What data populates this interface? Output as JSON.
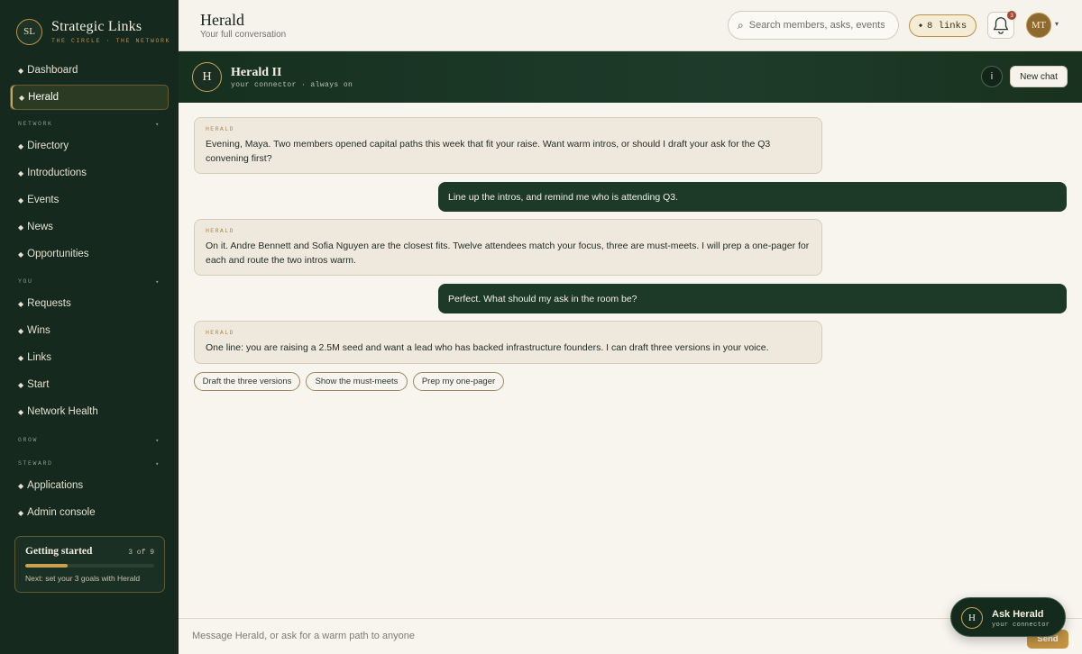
{
  "brand": {
    "mark": "SL",
    "name": "Strategic Links",
    "tagline": "THE CIRCLE · THE NETWORK"
  },
  "sidebar": {
    "items": [
      {
        "label": "Dashboard"
      },
      {
        "label": "Herald",
        "active": true
      },
      {
        "label": "Directory"
      },
      {
        "label": "Introductions"
      },
      {
        "label": "Events"
      },
      {
        "label": "News"
      },
      {
        "label": "Opportunities"
      },
      {
        "label": "Requests"
      },
      {
        "label": "Wins"
      },
      {
        "label": "Links"
      },
      {
        "label": "Start"
      },
      {
        "label": "Network Health"
      },
      {
        "label": "Applications"
      },
      {
        "label": "Admin console"
      }
    ],
    "sections": [
      "NETWORK",
      "YOU",
      "GROW",
      "STEWARD"
    ],
    "bullet": "◆",
    "caret": "▾"
  },
  "getting_started": {
    "title": "Getting started",
    "count": "3 of 9",
    "progress": 0.33,
    "next": "Next: set your 3 goals with Herald"
  },
  "header": {
    "title": "Herald",
    "subtitle": "Your full conversation",
    "search_placeholder": "Search members, asks, events",
    "links_label": "8 links",
    "notifications_count": "3",
    "avatar_initials": "MT"
  },
  "chat_header": {
    "avatar": "H",
    "name": "Herald II",
    "subtitle": "your connector · always on",
    "info_label": "i",
    "new_chat_label": "New chat"
  },
  "messages": [
    {
      "from": "HERALD",
      "text": "Evening, Maya. Two members opened capital paths this week that fit your raise. Want warm intros, or should I draft your ask for the Q3 convening first?"
    },
    {
      "from": "user",
      "text": "Line up the intros, and remind me who is attending Q3."
    },
    {
      "from": "HERALD",
      "text": "On it. Andre Bennett and Sofia Nguyen are the closest fits. Twelve attendees match your focus, three are must-meets. I will prep a one-pager for each and route the two intros warm."
    },
    {
      "from": "user",
      "text": "Perfect. What should my ask in the room be?"
    },
    {
      "from": "HERALD",
      "text": "One line: you are raising a 2.5M seed and want a lead who has backed infrastructure founders. I can draft three versions in your voice."
    }
  ],
  "chips": [
    "Draft the three versions",
    "Show the must-meets",
    "Prep my one-pager"
  ],
  "composer": {
    "placeholder": "Message Herald, or ask for a warm path to anyone",
    "send_label": "Send"
  },
  "ask_herald": {
    "avatar": "H",
    "title": "Ask Herald",
    "subtitle": "your connector"
  },
  "colors": {
    "sidebar_bg": "#15291e",
    "accent_gold": "#c49443",
    "bubble_out": "#1d3a29",
    "bubble_in": "#efe9dd"
  }
}
